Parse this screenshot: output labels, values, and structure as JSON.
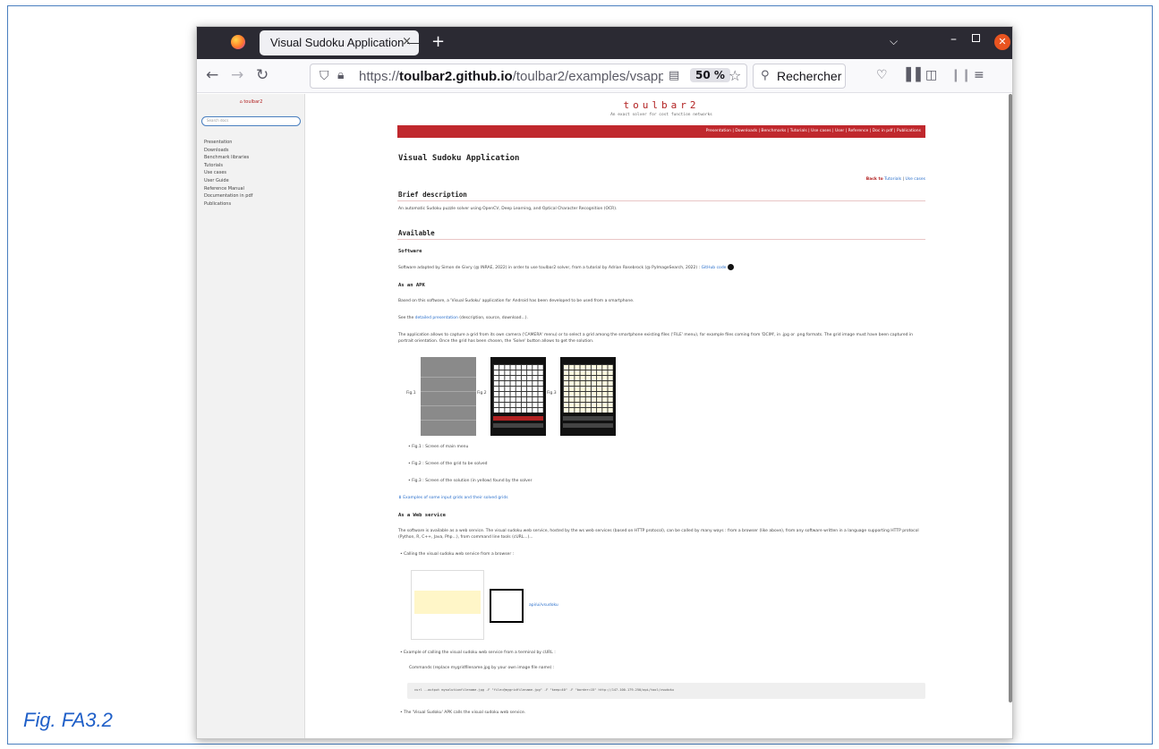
{
  "caption": "Fig. FA3.2",
  "browser": {
    "tab_title": "Visual Sudoku Application —",
    "tab_close": "×",
    "new_tab": "+",
    "url_prefix": "https://",
    "url_domain": "toulbar2.github.io",
    "url_path": "/toulbar2/examples/vsapp.html#v",
    "zoom": "50 %",
    "search_placeholder": "Rechercher"
  },
  "sidebar": {
    "brand": "toulbar2",
    "search_placeholder": "Search docs",
    "items": [
      "Presentation",
      "Downloads",
      "Benchmark libraries",
      "Tutorials",
      "Use cases",
      "User Guide",
      "Reference Manual",
      "Documentation in pdf",
      "Publications"
    ]
  },
  "page": {
    "site_title": "toulbar2",
    "site_tagline": "An exact solver for cost function networks",
    "topnav": "Presentation | Downloads | Benchmarks | Tutorials | Use cases | User | Reference | Doc in pdf | Publications",
    "title": "Visual Sudoku Application",
    "back_prefix": "Back to",
    "back_tutorials": "Tutorials",
    "back_sep": "|",
    "back_usecases": "Use cases",
    "brief_heading": "Brief description",
    "brief_text": "An automatic Sudoku puzzle solver using OpenCV, Deep Learning, and Optical Character Recognition (OCR).",
    "available_heading": "Available",
    "software_heading": "Software",
    "software_text": "Software adapted by Simon de Givry (@ INRAE, 2022) in order to use toulbar2 solver, from a tutorial by Adrian Rosebrock (@ PyImageSearch, 2022) :",
    "software_link": "GitHub code",
    "apk_heading": "As an APK",
    "apk_text1": "Based on this software, a 'Visual Sudoku' application for Android has been developed to be used from a smartphone.",
    "apk_text2_prefix": "See the",
    "apk_text2_link": "detailed presentation",
    "apk_text2_suffix": "(description, source, download...).",
    "apk_text3": "The application allows to capture a grid from its own camera ('CAMERA' menu) or to select a grid among the smartphone existing files ('FILE' menu), for example files coming from 'DCIM', in .jpg or .png formats. The grid image must have been captured in portrait orientation. Once the grid has been chosen, the 'Solve' button allows to get the solution.",
    "fig1_label": "Fig.1",
    "fig2_label": "Fig.2",
    "fig3_label": "Fig.3",
    "fig_items": [
      "• Fig.1 : Screen of main menu",
      "• Fig.2 : Screen of the grid to be solved",
      "• Fig.3 : Screen of the solution (in yellow) found by the solver"
    ],
    "examples_link": "⬇ Examples of some input grids and their solved grids",
    "web_heading": "As a Web service",
    "web_text": "The software is available as a web service. The visual sudoku web service, hosted by the ws web services (based on HTTP protocol), can be called by many ways : from a browser (like above), from any software written in a language supporting HTTP protocol (Python, R, C++, Java, Php...), from command line tools (cURL...)...",
    "web_bullet1": "• Calling the visual sudoku web service from a browser :",
    "qr_link": "api/ui/vsudoku",
    "web_bullet2": "• Example of calling the visual sudoku web service from a terminal by cURL :",
    "commands_text": "Commands (replace mygridfilename.jpg by your own image file name) :",
    "code": "curl --output mysolutionfilename.jpg -F \"file=@mygridfilename.jpg\" -F \"keep=40\" -F \"border=15\" http://147.100.179.250/api/tool/vsudoku",
    "web_bullet3": "• The 'Visual Sudoku' APK calls the visual sudoku web service."
  }
}
